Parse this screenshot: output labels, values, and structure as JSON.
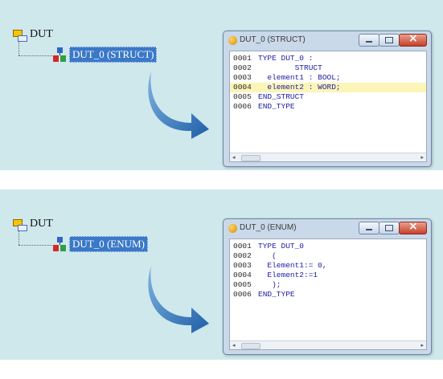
{
  "panels": [
    {
      "tree_root_label": "DUT",
      "tree_child_label": "DUT_0 (STRUCT)",
      "window_title": "DUT_0 (STRUCT)",
      "lines": [
        {
          "num": "0001",
          "code": "TYPE DUT_0 :"
        },
        {
          "num": "0002",
          "code": "        STRUCT"
        },
        {
          "num": "0003",
          "code": "  element1 : BOOL;"
        },
        {
          "num": "0004",
          "code": "  element2 : WORD;"
        },
        {
          "num": "0005",
          "code": "END_STRUCT"
        },
        {
          "num": "0006",
          "code": "END_TYPE"
        }
      ],
      "highlighted_line": "0004"
    },
    {
      "tree_root_label": "DUT",
      "tree_child_label": "DUT_0 (ENUM)",
      "window_title": "DUT_0 (ENUM)",
      "lines": [
        {
          "num": "0001",
          "code": "TYPE DUT_0"
        },
        {
          "num": "0002",
          "code": "   ("
        },
        {
          "num": "0003",
          "code": "  Element1:= 0,"
        },
        {
          "num": "0004",
          "code": "  Element2:=1"
        },
        {
          "num": "0005",
          "code": "   );"
        },
        {
          "num": "0006",
          "code": "END_TYPE"
        }
      ],
      "highlighted_line": ""
    }
  ],
  "icons": {
    "folder": "folder-icon",
    "dut": "dut-icon",
    "window": "window-app-icon",
    "arrow": "curved-arrow-icon"
  },
  "colors": {
    "panel_bg": "#cfe8ec",
    "selection": "#3a78c8",
    "code_text": "#2020a8",
    "highlight_line": "#fbf6b8",
    "arrow": "#1f6fb8"
  }
}
